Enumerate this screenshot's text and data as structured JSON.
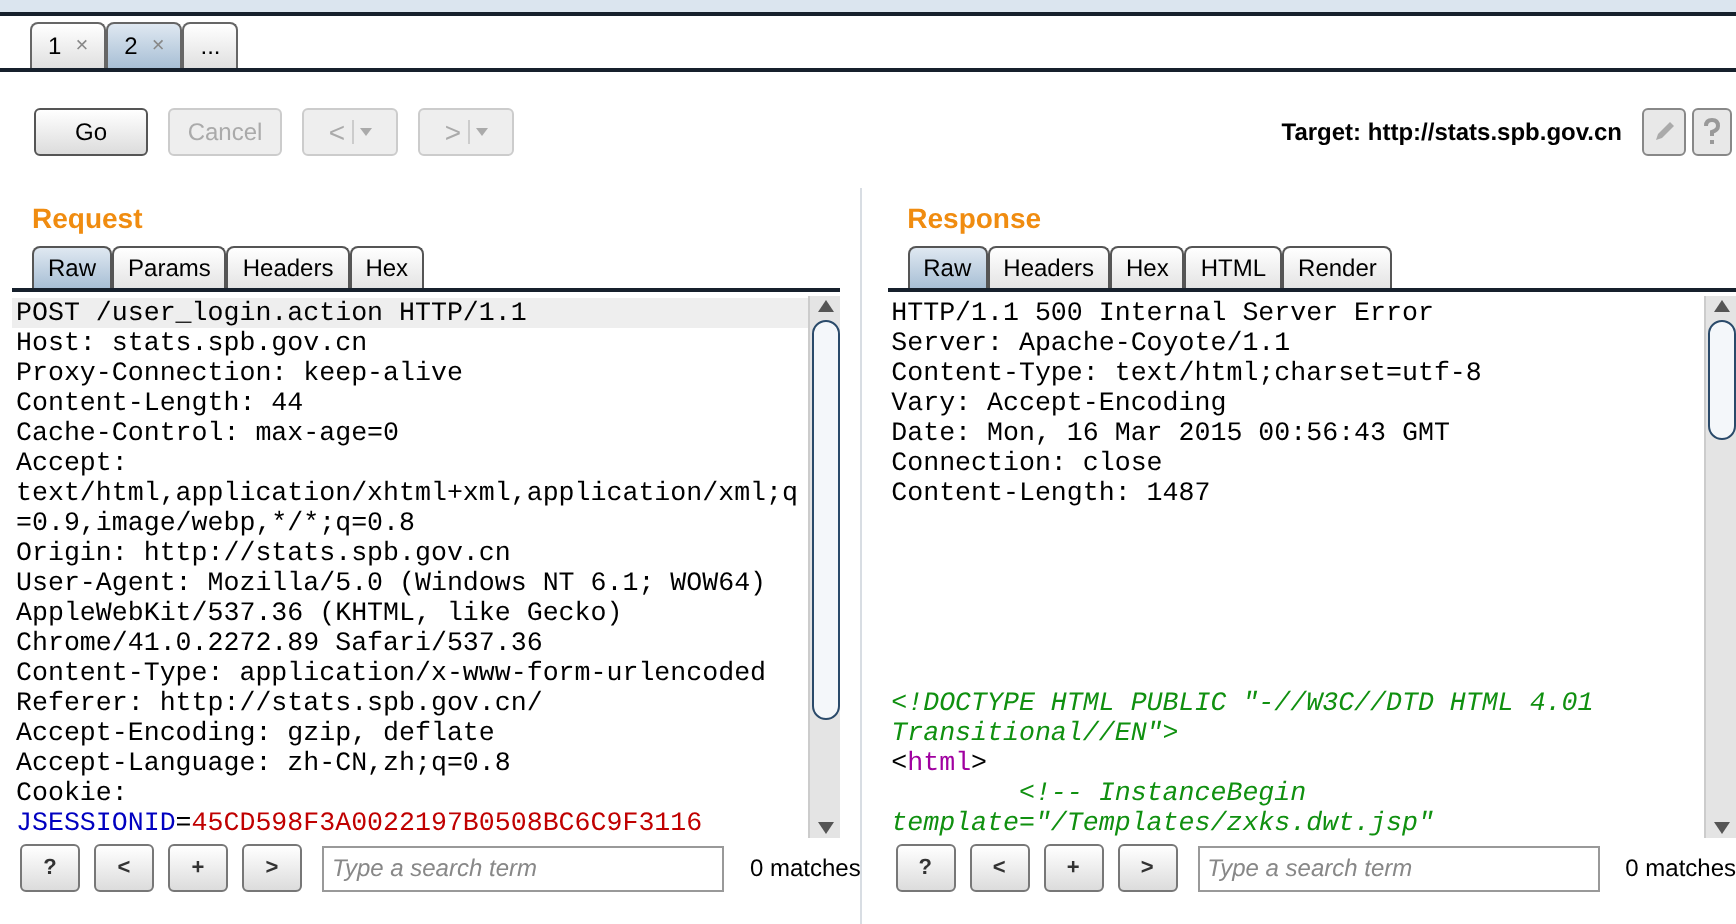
{
  "session_tabs": [
    {
      "label": "1",
      "close": "×",
      "selected": false
    },
    {
      "label": "2",
      "close": "×",
      "selected": true
    },
    {
      "label": "...",
      "selected": false
    }
  ],
  "toolbar": {
    "buttons": [
      {
        "label": "Go",
        "disabled": false
      },
      {
        "label": "Cancel",
        "disabled": true
      }
    ],
    "history": [
      {
        "label": "<",
        "disabled": true
      },
      {
        "label": ">",
        "disabled": true
      }
    ],
    "target": "Target: http://stats.spb.gov.cn"
  },
  "panels": [
    {
      "title": "Request",
      "tabs": [
        {
          "label": "Raw",
          "selected": true
        },
        {
          "label": "Params",
          "selected": false
        },
        {
          "label": "Headers",
          "selected": false
        },
        {
          "label": "Hex",
          "selected": false
        }
      ],
      "lines": [
        {
          "segments": [
            {
              "kind": "plain",
              "text": "POST /user_login.action HTTP/1.1"
            }
          ],
          "selected": true
        },
        {
          "segments": [
            {
              "kind": "plain",
              "text": "Host: stats.spb.gov.cn"
            }
          ],
          "selected": false
        },
        {
          "segments": [
            {
              "kind": "plain",
              "text": "Proxy-Connection: keep-alive"
            }
          ],
          "selected": false
        },
        {
          "segments": [
            {
              "kind": "plain",
              "text": "Content-Length: 44"
            }
          ],
          "selected": false
        },
        {
          "segments": [
            {
              "kind": "plain",
              "text": "Cache-Control: max-age=0"
            }
          ],
          "selected": false
        },
        {
          "segments": [
            {
              "kind": "plain",
              "text": "Accept:"
            }
          ],
          "selected": false
        },
        {
          "segments": [
            {
              "kind": "plain",
              "text": "text/html,application/xhtml+xml,application/xml;q"
            }
          ],
          "selected": false
        },
        {
          "segments": [
            {
              "kind": "plain",
              "text": "=0.9,image/webp,*/*;q=0.8"
            }
          ],
          "selected": false
        },
        {
          "segments": [
            {
              "kind": "plain",
              "text": "Origin: http://stats.spb.gov.cn"
            }
          ],
          "selected": false
        },
        {
          "segments": [
            {
              "kind": "plain",
              "text": "User-Agent: Mozilla/5.0 (Windows NT 6.1; WOW64)"
            }
          ],
          "selected": false
        },
        {
          "segments": [
            {
              "kind": "plain",
              "text": "AppleWebKit/537.36 (KHTML, like Gecko)"
            }
          ],
          "selected": false
        },
        {
          "segments": [
            {
              "kind": "plain",
              "text": "Chrome/41.0.2272.89 Safari/537.36"
            }
          ],
          "selected": false
        },
        {
          "segments": [
            {
              "kind": "plain",
              "text": "Content-Type: application/x-www-form-urlencoded"
            }
          ],
          "selected": false
        },
        {
          "segments": [
            {
              "kind": "plain",
              "text": "Referer: http://stats.spb.gov.cn/"
            }
          ],
          "selected": false
        },
        {
          "segments": [
            {
              "kind": "plain",
              "text": "Accept-Encoding: gzip, deflate"
            }
          ],
          "selected": false
        },
        {
          "segments": [
            {
              "kind": "plain",
              "text": "Accept-Language: zh-CN,zh;q=0.8"
            }
          ],
          "selected": false
        },
        {
          "segments": [
            {
              "kind": "plain",
              "text": "Cookie:"
            }
          ],
          "selected": false
        },
        {
          "segments": [
            {
              "kind": "name",
              "text": "JSESSIONID"
            },
            {
              "kind": "plain",
              "text": "="
            },
            {
              "kind": "value",
              "text": "45CD598F3A0022197B0508BC6C9F3116"
            }
          ],
          "selected": false
        }
      ],
      "search": {
        "buttons": [
          "?",
          "<",
          "+",
          ">"
        ],
        "placeholder": "Type a search term",
        "matches": "0 matches"
      }
    },
    {
      "title": "Response",
      "tabs": [
        {
          "label": "Raw",
          "selected": true
        },
        {
          "label": "Headers",
          "selected": false
        },
        {
          "label": "Hex",
          "selected": false
        },
        {
          "label": "HTML",
          "selected": false
        },
        {
          "label": "Render",
          "selected": false
        }
      ],
      "lines": [
        {
          "segments": [
            {
              "kind": "plain",
              "text": "HTTP/1.1 500 Internal Server Error"
            }
          ],
          "selected": false
        },
        {
          "segments": [
            {
              "kind": "plain",
              "text": "Server: Apache-Coyote/1.1"
            }
          ],
          "selected": false
        },
        {
          "segments": [
            {
              "kind": "plain",
              "text": "Content-Type: text/html;charset=utf-8"
            }
          ],
          "selected": false
        },
        {
          "segments": [
            {
              "kind": "plain",
              "text": "Vary: Accept-Encoding"
            }
          ],
          "selected": false
        },
        {
          "segments": [
            {
              "kind": "plain",
              "text": "Date: Mon, 16 Mar 2015 00:56:43 GMT"
            }
          ],
          "selected": false
        },
        {
          "segments": [
            {
              "kind": "plain",
              "text": "Connection: close"
            }
          ],
          "selected": false
        },
        {
          "segments": [
            {
              "kind": "plain",
              "text": "Content-Length: 1487"
            }
          ],
          "selected": false
        },
        {
          "kind": "blank"
        },
        {
          "kind": "blank"
        },
        {
          "kind": "blank"
        },
        {
          "kind": "blank"
        },
        {
          "kind": "blank"
        },
        {
          "kind": "blank"
        },
        {
          "segments": [
            {
              "kind": "comment",
              "text": "<!DOCTYPE HTML PUBLIC \"-//W3C//DTD HTML 4.01"
            }
          ],
          "selected": false
        },
        {
          "segments": [
            {
              "kind": "comment",
              "text": "Transitional//EN\">"
            }
          ],
          "selected": false
        },
        {
          "segments": [
            {
              "kind": "plain",
              "text": "<"
            },
            {
              "kind": "tag",
              "text": "html"
            },
            {
              "kind": "plain",
              "text": ">"
            }
          ],
          "selected": false
        },
        {
          "segments": [
            {
              "kind": "comment",
              "text": "        <!-- InstanceBegin"
            }
          ],
          "selected": false
        },
        {
          "segments": [
            {
              "kind": "comment",
              "text": "template=\"/Templates/zxks.dwt.jsp\""
            }
          ],
          "selected": false
        }
      ],
      "search": {
        "buttons": [
          "?",
          "<",
          "+",
          ">"
        ],
        "placeholder": "Type a search term",
        "matches": "0 matches"
      }
    }
  ]
}
